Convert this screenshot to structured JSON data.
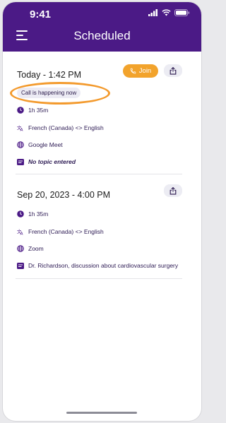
{
  "status_bar": {
    "time": "9:41"
  },
  "header": {
    "title": "Scheduled"
  },
  "calls": [
    {
      "date": "Today - 1:42 PM",
      "join_label": "Join",
      "badge": "Call is happening now",
      "duration": "1h 35m",
      "languages": "French (Canada) <> English",
      "platform": "Google Meet",
      "topic": "No topic entered"
    },
    {
      "date": "Sep 20, 2023 - 4:00 PM",
      "duration": "1h 35m",
      "languages": "French (Canada) <> English",
      "platform": "Zoom",
      "topic": "Dr. Richardson, discussion about cardiovascular surgery"
    }
  ],
  "colors": {
    "header_bg": "#4b1a86",
    "join_bg": "#f2a32c",
    "highlight": "#f39a2d",
    "icon": "#4b1a86"
  },
  "icons": [
    "menu-icon",
    "phone-icon",
    "share-icon",
    "clock-icon",
    "translate-icon",
    "globe-icon",
    "topic-icon"
  ]
}
